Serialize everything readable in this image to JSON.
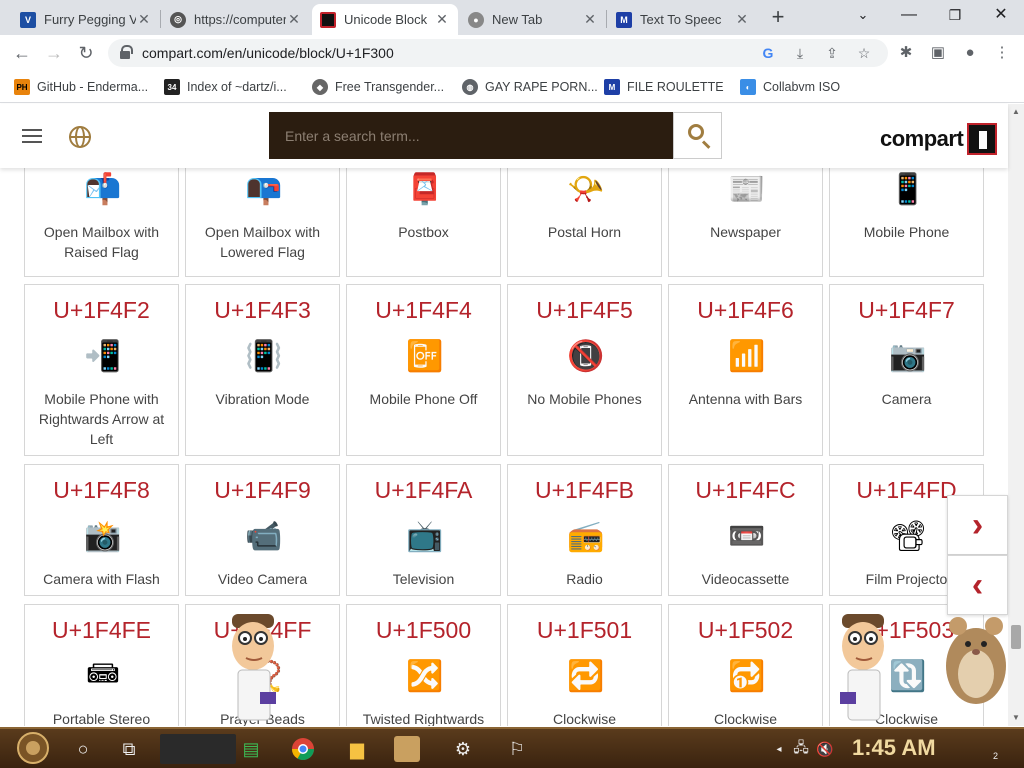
{
  "browser": {
    "tabs": [
      {
        "title": "Furry Pegging Vi",
        "favicon": "vidlii-icon",
        "active": false
      },
      {
        "title": "https://computer",
        "favicon": "site-icon",
        "active": false
      },
      {
        "title": "Unicode Block",
        "favicon": "compart-icon",
        "active": true
      },
      {
        "title": "New Tab",
        "favicon": "chrome-icon",
        "active": false
      },
      {
        "title": "Text To Speec",
        "favicon": "tts-icon",
        "active": false
      }
    ],
    "url": "compart.com/en/unicode/block/U+1F300",
    "bookmarks": [
      {
        "label": "GitHub - Enderma...",
        "icon": "ph-icon"
      },
      {
        "label": "Index of ~dartz/i...",
        "icon": "index-icon"
      },
      {
        "label": "Free Transgender...",
        "icon": "hat-icon"
      },
      {
        "label": "GAY RAPE PORN...",
        "icon": "globe-icon"
      },
      {
        "label": "FILE ROULETTE",
        "icon": "file-icon"
      },
      {
        "label": "Collabvm ISO",
        "icon": "collabvm-icon"
      }
    ]
  },
  "page": {
    "search_placeholder": "Enter a search term...",
    "logo_text": "compart",
    "cards": [
      {
        "code": "",
        "name": "Open Mailbox with Raised Flag",
        "glyph": "📬"
      },
      {
        "code": "",
        "name": "Open Mailbox with Lowered Flag",
        "glyph": "📭"
      },
      {
        "code": "",
        "name": "Postbox",
        "glyph": "📮"
      },
      {
        "code": "",
        "name": "Postal Horn",
        "glyph": "📯"
      },
      {
        "code": "",
        "name": "Newspaper",
        "glyph": "📰"
      },
      {
        "code": "",
        "name": "Mobile Phone",
        "glyph": "📱"
      },
      {
        "code": "U+1F4F2",
        "name": "Mobile Phone with Rightwards Arrow at Left",
        "glyph": "📲"
      },
      {
        "code": "U+1F4F3",
        "name": "Vibration Mode",
        "glyph": "📳"
      },
      {
        "code": "U+1F4F4",
        "name": "Mobile Phone Off",
        "glyph": "📴"
      },
      {
        "code": "U+1F4F5",
        "name": "No Mobile Phones",
        "glyph": "📵"
      },
      {
        "code": "U+1F4F6",
        "name": "Antenna with Bars",
        "glyph": "📶"
      },
      {
        "code": "U+1F4F7",
        "name": "Camera",
        "glyph": "📷"
      },
      {
        "code": "U+1F4F8",
        "name": "Camera with Flash",
        "glyph": "📸"
      },
      {
        "code": "U+1F4F9",
        "name": "Video Camera",
        "glyph": "📹"
      },
      {
        "code": "U+1F4FA",
        "name": "Television",
        "glyph": "📺"
      },
      {
        "code": "U+1F4FB",
        "name": "Radio",
        "glyph": "📻"
      },
      {
        "code": "U+1F4FC",
        "name": "Videocassette",
        "glyph": "📼"
      },
      {
        "code": "U+1F4FD",
        "name": "Film Projecto",
        "glyph": "📽"
      },
      {
        "code": "U+1F4FE",
        "name": "Portable Stereo",
        "glyph": "📾"
      },
      {
        "code": "U+1F4FF",
        "name": "Prayer Beads",
        "glyph": "📿"
      },
      {
        "code": "U+1F500",
        "name": "Twisted Rightwards",
        "glyph": "🔀"
      },
      {
        "code": "U+1F501",
        "name": "Clockwise",
        "glyph": "🔁"
      },
      {
        "code": "U+1F502",
        "name": "Clockwise",
        "glyph": "🔂"
      },
      {
        "code": "U+1F503",
        "name": "Clockwise",
        "glyph": "🔃"
      }
    ],
    "next_arrow": "›",
    "prev_arrow": "‹"
  },
  "taskbar": {
    "clock": "1:45 AM",
    "notification_count": "2"
  },
  "colors": {
    "accent_red": "#b4232b",
    "search_bg": "#2b1d10",
    "icon_gold": "#a07d40"
  }
}
